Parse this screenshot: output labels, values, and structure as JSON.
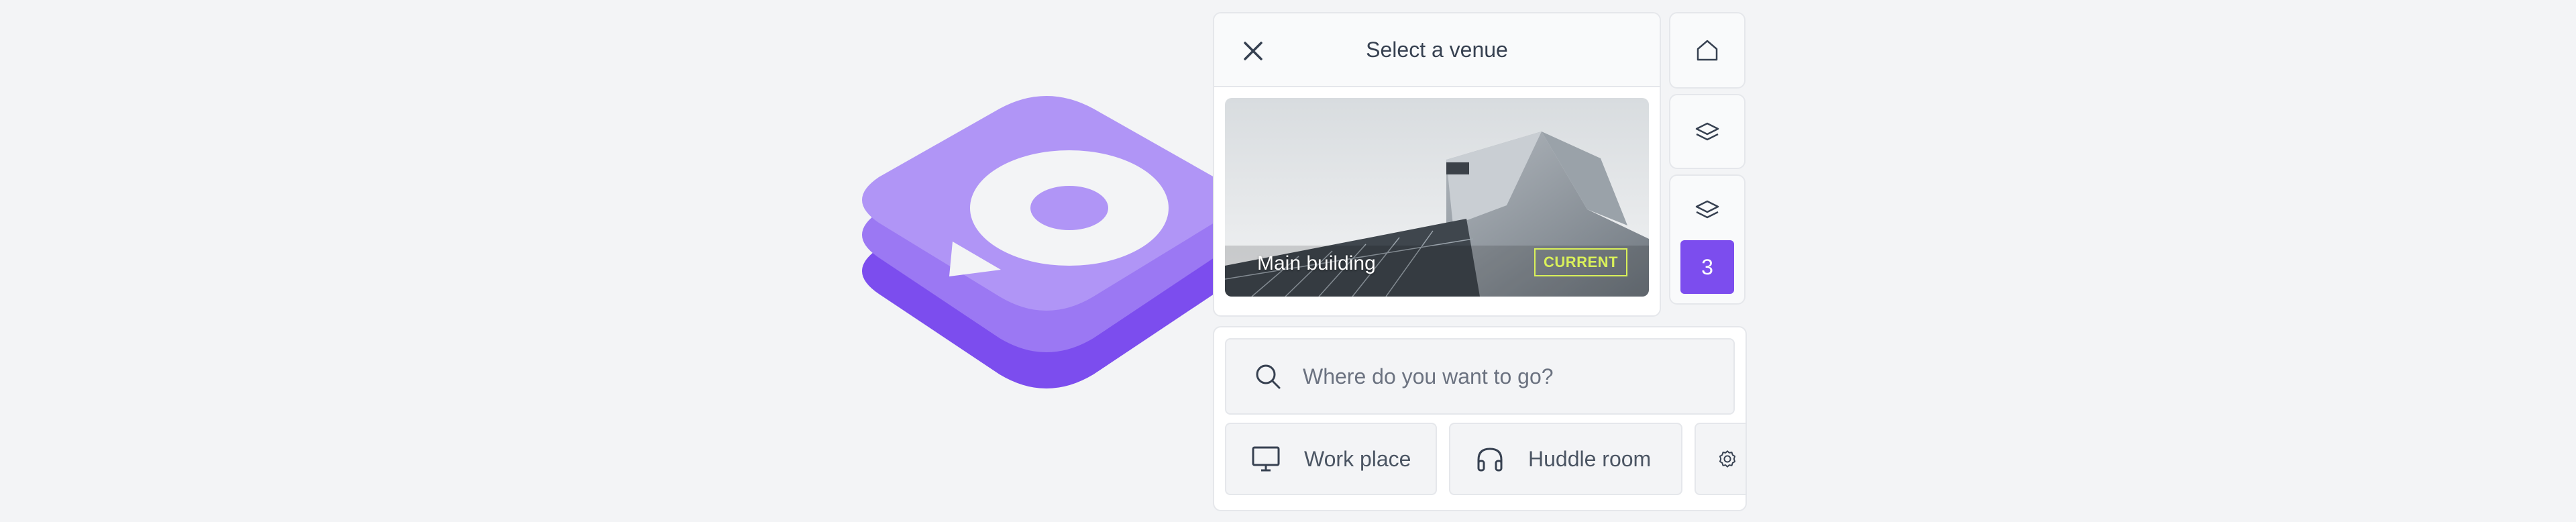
{
  "logo": {
    "name": "venue-app-logo",
    "colors": {
      "top": "#b095f6",
      "middle": "#9b78f3",
      "bottom": "#7c4dee",
      "bubble": "#f3f4f6"
    }
  },
  "venue_panel": {
    "title": "Select a venue",
    "close_icon": "close-icon",
    "venues": [
      {
        "name": "Main building",
        "badge": "CURRENT"
      }
    ]
  },
  "side_controls": {
    "home_icon": "home-icon",
    "layers_icon": "layers-icon",
    "floor_icon": "layers-icon",
    "floor_number": "3"
  },
  "search": {
    "placeholder": "Where do you want to go?",
    "icon": "search-icon"
  },
  "categories": [
    {
      "label": "Work place",
      "icon": "monitor-icon"
    },
    {
      "label": "Huddle room",
      "icon": "headphones-icon"
    },
    {
      "label": "",
      "icon": "settings-icon"
    }
  ],
  "colors": {
    "accent": "#7c4dee",
    "badge": "#d9f05a",
    "background": "#f3f4f6"
  }
}
